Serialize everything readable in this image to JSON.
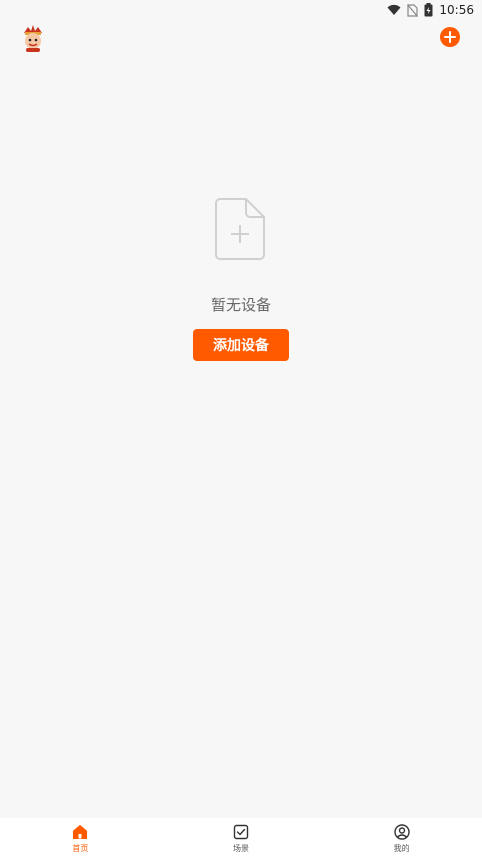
{
  "status_bar": {
    "time": "10:56",
    "icons": [
      "wifi-icon",
      "no-sim-icon",
      "battery-charging-icon"
    ]
  },
  "header": {
    "logo_icon": "mascot-logo-icon",
    "add_icon": "plus-circle-icon"
  },
  "empty_state": {
    "icon": "document-plus-icon",
    "message": "暂无设备",
    "button_label": "添加设备"
  },
  "bottom_nav": {
    "items": [
      {
        "label": "首页",
        "icon": "home-icon",
        "active": true
      },
      {
        "label": "场景",
        "icon": "check-square-icon",
        "active": false
      },
      {
        "label": "我的",
        "icon": "user-circle-icon",
        "active": false
      }
    ]
  },
  "colors": {
    "accent": "#ff5a00",
    "background": "#f7f7f7",
    "nav_background": "#ffffff",
    "muted_text": "#666666"
  }
}
